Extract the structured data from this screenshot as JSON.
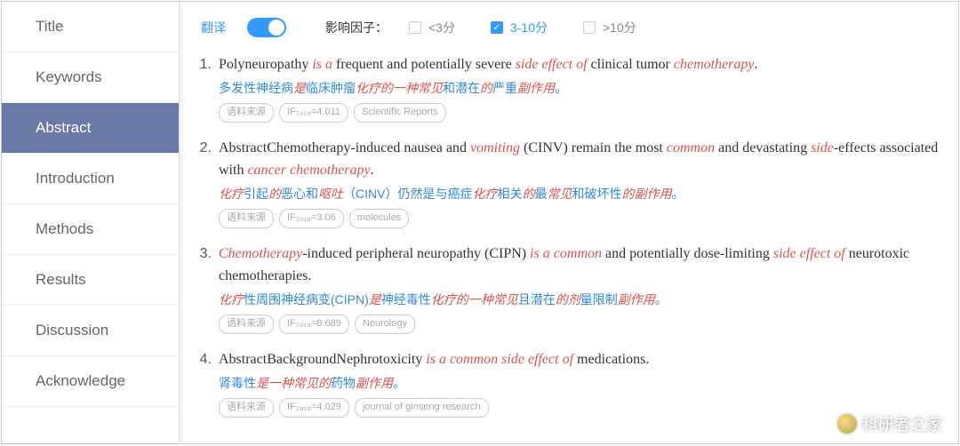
{
  "sidebar": {
    "items": [
      {
        "label": "Title"
      },
      {
        "label": "Keywords"
      },
      {
        "label": "Abstract"
      },
      {
        "label": "Introduction"
      },
      {
        "label": "Methods"
      },
      {
        "label": "Results"
      },
      {
        "label": "Discussion"
      },
      {
        "label": "Acknowledge"
      }
    ],
    "active_index": 2
  },
  "filters": {
    "translate_label": "翻译",
    "factor_label": "影响因子：",
    "options": [
      {
        "label": "<3分",
        "checked": false
      },
      {
        "label": "3-10分",
        "checked": true
      },
      {
        "label": ">10分",
        "checked": false
      }
    ]
  },
  "results": [
    {
      "num": "1.",
      "en_segments": [
        {
          "t": "Polyneuropathy ",
          "hl": false
        },
        {
          "t": "is a",
          "hl": true
        },
        {
          "t": " frequent and potentially severe ",
          "hl": false
        },
        {
          "t": "side effect of",
          "hl": true
        },
        {
          "t": " clinical tumor ",
          "hl": false
        },
        {
          "t": "chemotherapy",
          "hl": true
        },
        {
          "t": ".",
          "hl": false
        }
      ],
      "zh_segments": [
        {
          "t": "多发性神经病",
          "hl": false
        },
        {
          "t": "是",
          "hl": true
        },
        {
          "t": "临床肿瘤",
          "hl": false
        },
        {
          "t": "化疗的一种常见",
          "hl": true
        },
        {
          "t": "和潜在",
          "hl": false
        },
        {
          "t": "的",
          "hl": true
        },
        {
          "t": "严重",
          "hl": false
        },
        {
          "t": "副作用",
          "hl": true
        },
        {
          "t": "。",
          "hl": false
        }
      ],
      "tags": {
        "src": "语料来源",
        "if": "IF₂₀₁₈=4.011",
        "journal": "Scientific Reports"
      }
    },
    {
      "num": "2.",
      "en_segments": [
        {
          "t": "AbstractChemotherapy-induced nausea and ",
          "hl": false
        },
        {
          "t": "vomiting",
          "hl": true
        },
        {
          "t": " (CINV) remain the most ",
          "hl": false
        },
        {
          "t": "common",
          "hl": true
        },
        {
          "t": " and devastating ",
          "hl": false
        },
        {
          "t": "side",
          "hl": true
        },
        {
          "t": "-effects associated with ",
          "hl": false
        },
        {
          "t": "cancer chemotherapy",
          "hl": true
        },
        {
          "t": ".",
          "hl": false
        }
      ],
      "zh_segments": [
        {
          "t": "化疗",
          "hl": true
        },
        {
          "t": "引起",
          "hl": false
        },
        {
          "t": "的",
          "hl": true
        },
        {
          "t": "恶心和",
          "hl": false
        },
        {
          "t": "呕吐",
          "hl": true
        },
        {
          "t": "（CINV）仍然是与癌症",
          "hl": false
        },
        {
          "t": "化疗",
          "hl": true
        },
        {
          "t": "相关",
          "hl": false
        },
        {
          "t": "的",
          "hl": true
        },
        {
          "t": "最",
          "hl": false
        },
        {
          "t": "常见",
          "hl": true
        },
        {
          "t": "和破坏性",
          "hl": false
        },
        {
          "t": "的副作用",
          "hl": true
        },
        {
          "t": "。",
          "hl": false
        }
      ],
      "tags": {
        "src": "语料来源",
        "if": "IF₂₀₁₈=3.06",
        "journal": "molecules"
      }
    },
    {
      "num": "3.",
      "en_segments": [
        {
          "t": "Chemotherapy",
          "hl": true
        },
        {
          "t": "-induced peripheral neuropathy (CIPN) ",
          "hl": false
        },
        {
          "t": "is a common",
          "hl": true
        },
        {
          "t": " and potentially dose-limiting ",
          "hl": false
        },
        {
          "t": "side effect of",
          "hl": true
        },
        {
          "t": " neurotoxic chemotherapies.",
          "hl": false
        }
      ],
      "zh_segments": [
        {
          "t": "化疗",
          "hl": true
        },
        {
          "t": "性周围神经病变(CIPN)",
          "hl": false
        },
        {
          "t": "是",
          "hl": true
        },
        {
          "t": "神经毒性",
          "hl": false
        },
        {
          "t": "化疗的一种常见",
          "hl": true
        },
        {
          "t": "且潜在",
          "hl": false
        },
        {
          "t": "的剂",
          "hl": true
        },
        {
          "t": "量限制",
          "hl": false
        },
        {
          "t": "副作用",
          "hl": true
        },
        {
          "t": "。",
          "hl": false
        }
      ],
      "tags": {
        "src": "语料来源",
        "if": "IF₂₀₁₈=8.689",
        "journal": "Neurology"
      }
    },
    {
      "num": "4.",
      "en_segments": [
        {
          "t": "AbstractBackgroundNephrotoxicity ",
          "hl": false
        },
        {
          "t": "is a common side effect of",
          "hl": true
        },
        {
          "t": " medications.",
          "hl": false
        }
      ],
      "zh_segments": [
        {
          "t": "肾毒性",
          "hl": false
        },
        {
          "t": "是一种常见的",
          "hl": true
        },
        {
          "t": "药物",
          "hl": false
        },
        {
          "t": "副作用",
          "hl": true
        },
        {
          "t": "。",
          "hl": false
        }
      ],
      "tags": {
        "src": "语料来源",
        "if": "IF₂₀₁₈=4.029",
        "journal": "journal of ginseng research"
      }
    }
  ],
  "watermark": "科研者之家"
}
